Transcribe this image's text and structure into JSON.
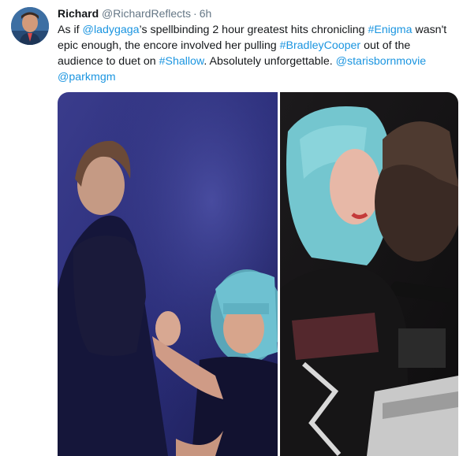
{
  "tweet": {
    "author_name": "Richard",
    "author_handle": "@RichardReflects",
    "separator": "·",
    "time": "6h",
    "text": {
      "p1": "As if ",
      "m1": "@ladygaga",
      "p2": "’s spellbinding 2 hour greatest hits chronicling ",
      "h1": "#Enigma",
      "p3": " wasn't epic enough, the encore involved her pulling ",
      "h2": "#BradleyCooper",
      "p4": " out of the audience to duet on ",
      "h3": "#Shallow",
      "p5": ". Absolutely unforgettable. ",
      "m2": "@starisbornmovie",
      "p6": " ",
      "m3": "@parkmgm"
    }
  },
  "colors": {
    "link": "#1b95e0",
    "muted": "#657786",
    "text": "#14171a"
  }
}
